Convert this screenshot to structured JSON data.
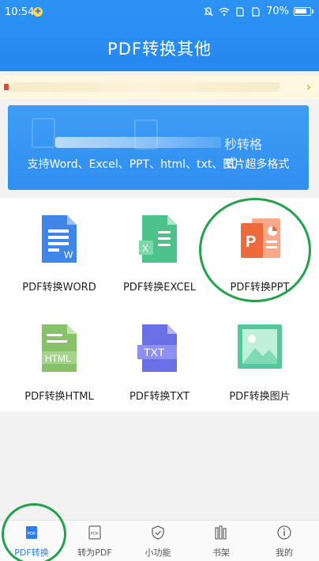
{
  "status": {
    "time": "10:54",
    "battery": "70%"
  },
  "header": {
    "title": "PDF转换其他"
  },
  "banner": {
    "line1_tail": "秒转格式",
    "line2": "支持Word、Excel、PPT、html、txt、图片超多格式"
  },
  "grid": [
    {
      "label": "PDF转换WORD",
      "icon": "word-doc-icon",
      "color": "#3f86e8"
    },
    {
      "label": "PDF转换EXCEL",
      "icon": "excel-doc-icon",
      "color": "#4cc38a"
    },
    {
      "label": "PDF转换PPT",
      "icon": "ppt-doc-icon",
      "color": "#ef6a3a"
    },
    {
      "label": "PDF转换HTML",
      "icon": "html-doc-icon",
      "color": "#87c26a"
    },
    {
      "label": "PDF转换TXT",
      "icon": "txt-doc-icon",
      "color": "#6b6fe6"
    },
    {
      "label": "PDF转换图片",
      "icon": "image-icon",
      "color": "#55c79a"
    }
  ],
  "tabs": [
    {
      "label": "PDF转换",
      "icon": "pdf-icon",
      "active": true
    },
    {
      "label": "转为PDF",
      "icon": "to-pdf-icon",
      "active": false
    },
    {
      "label": "小功能",
      "icon": "shield-icon",
      "active": false
    },
    {
      "label": "书架",
      "icon": "bookshelf-icon",
      "active": false
    },
    {
      "label": "我的",
      "icon": "info-icon",
      "active": false
    }
  ]
}
